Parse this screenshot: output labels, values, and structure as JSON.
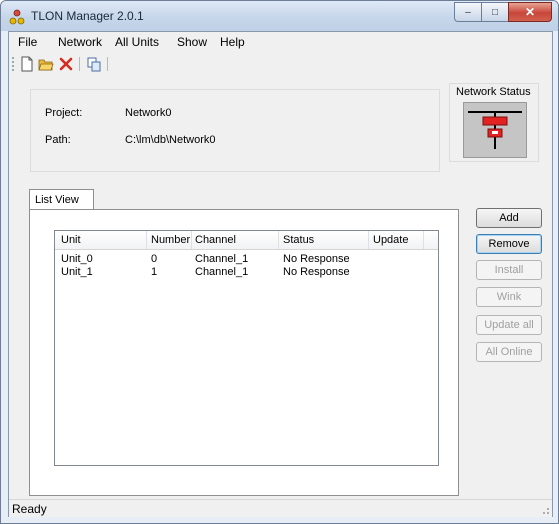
{
  "window": {
    "title": "TLON Manager 2.0.1",
    "caption": {
      "minimize": "–",
      "maximize": "□",
      "close": "✕"
    }
  },
  "menu": [
    "File",
    "Network",
    "All Units",
    "Show",
    "Help"
  ],
  "toolbar": {
    "icons": [
      "new-document-icon",
      "open-folder-icon",
      "delete-icon",
      "copy-icon"
    ]
  },
  "project": {
    "project_label": "Project:",
    "project_value": "Network0",
    "path_label": "Path:",
    "path_value": "C:\\lm\\db\\Network0"
  },
  "network_status": {
    "title": "Network Status",
    "state_color": "#e32222"
  },
  "tabs": [
    "List View"
  ],
  "list": {
    "columns": [
      "Unit",
      "Number",
      "Channel",
      "Status",
      "Update"
    ],
    "rows": [
      {
        "unit": "Unit_0",
        "number": "0",
        "channel": "Channel_1",
        "status": "No Response",
        "update": ""
      },
      {
        "unit": "Unit_1",
        "number": "1",
        "channel": "Channel_1",
        "status": "No Response",
        "update": ""
      }
    ]
  },
  "buttons": {
    "add": "Add",
    "remove": "Remove",
    "install": "Install",
    "wink": "Wink",
    "update_all": "Update all",
    "all_online": "All Online"
  },
  "status": {
    "text": "Ready"
  }
}
